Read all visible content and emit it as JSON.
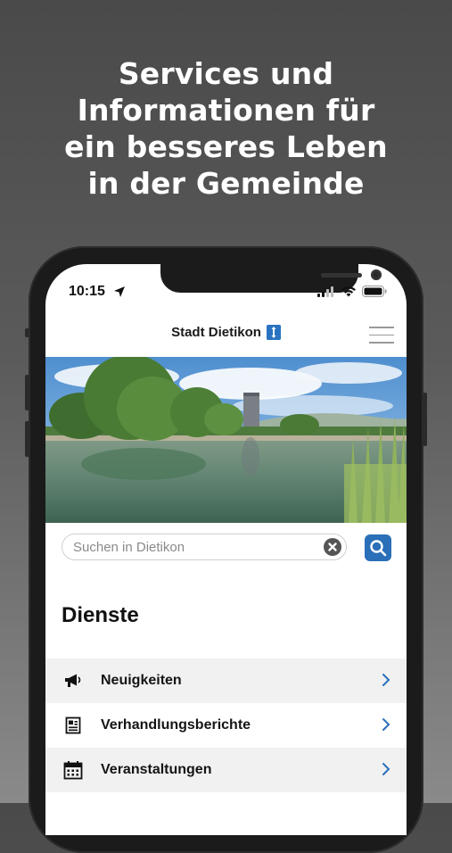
{
  "promo": {
    "headline_lines": [
      "Services und",
      "Informationen für",
      "ein besseres Leben",
      "in der Gemeinde"
    ]
  },
  "status_bar": {
    "time": "10:15"
  },
  "header": {
    "title": "Stadt Dietikon",
    "crest_icon": "dietikon-crest-icon",
    "menu_icon": "hamburger-menu-icon"
  },
  "search": {
    "placeholder": "Suchen in Dietikon"
  },
  "services": {
    "title": "Dienste",
    "items": [
      {
        "label": "Neuigkeiten",
        "icon": "megaphone-icon"
      },
      {
        "label": "Verhandlungsberichte",
        "icon": "report-icon"
      },
      {
        "label": "Veranstaltungen",
        "icon": "calendar-icon"
      }
    ]
  },
  "colors": {
    "accent": "#2a6fb8",
    "crest": "#2a73c2"
  }
}
